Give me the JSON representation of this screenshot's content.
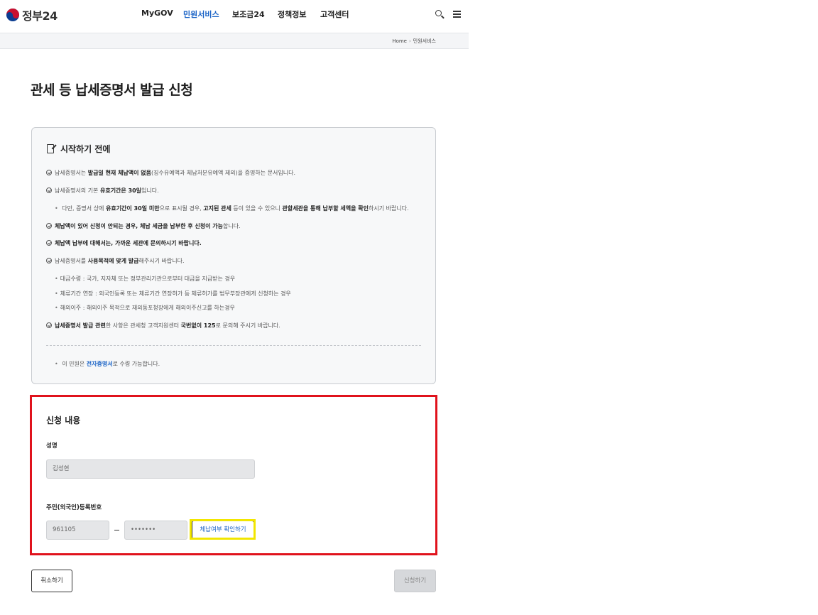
{
  "header": {
    "logo_text": "정부24",
    "nav": [
      "MyGOV",
      "민원서비스",
      "보조금24",
      "정책정보",
      "고객센터"
    ],
    "active_nav": "민원서비스",
    "icons": [
      "search-icon",
      "menu-icon"
    ]
  },
  "breadcrumb": {
    "home": "Home",
    "current": "민원서비스"
  },
  "page": {
    "title": "관세 등 납세증명서 발급 신청"
  },
  "notice": {
    "title": "시작하기 전에",
    "items": {
      "i1": {
        "pre": "납세증명서는 ",
        "b1": "발급일 현재 체납액이 없음",
        "post": "(징수유예액과 체납처분유예액 제외)을 증명하는 문서입니다."
      },
      "i2": {
        "pre": "납세증명서의 기본 ",
        "b1": "유효기간은 30일",
        "post": "입니다."
      },
      "i2sub": {
        "pre": "다만, 증명서 상에 ",
        "b1": "유효기간이 30일 미만",
        "mid": "으로 표시될 경우, ",
        "b2": "고지된 관세",
        "mid2": " 등이 있을 수 있으니 ",
        "b3": "관할세관을 통해 납부할 세액을 확인",
        "post": "하시기 바랍니다."
      },
      "i3": {
        "b1": "체납액이 있어 신청이 안되는 경우, 체납 세금을 납부한 후 신청이 가능",
        "post": "합니다."
      },
      "i4": {
        "b1": "체납액 납부에 대해서는, 가까운 세관에 문의하시기 바랍니다."
      },
      "i5": {
        "pre": "납세증명서를 ",
        "b1": "사용목적에 맞게 발급",
        "post": "해주시기 바랍니다."
      },
      "i5sub1": "대금수령 : 국가, 지자체 또는 정부관리기관으로부터 대금을 지급받는 경우",
      "i5sub2": "체류기간 연장 : 외국인등록 또는 체류기간 연장허가 등 체류허가를 법무부장관에게 신청하는 경우",
      "i5sub3": "해외이주 : 해외이주 목적으로 재외동포청장에게 해외이주신고를 하는경우",
      "i6": {
        "b1": "납세증명서 발급 관련",
        "mid": "한 사항은 관세청 고객지원센터 ",
        "b2": "국번없이 125",
        "post": "로 문의해 주시기 바랍니다."
      }
    },
    "footer": {
      "pre": "이 민원은 ",
      "link": "전자증명서",
      "post": "로 수령 가능합니다."
    }
  },
  "form": {
    "title": "신청 내용",
    "name_label": "성명",
    "name_value": "김성현",
    "rrn_label": "주민(외국인)등록번호",
    "rrn_front": "961105",
    "rrn_back": "•••••••",
    "check_button": "체납여부 확인하기"
  },
  "actions": {
    "cancel": "취소하기",
    "apply": "신청하기"
  },
  "colors": {
    "accent": "#1a63c6",
    "highlight_red": "#e0121c",
    "highlight_yellow": "#f2e600"
  }
}
